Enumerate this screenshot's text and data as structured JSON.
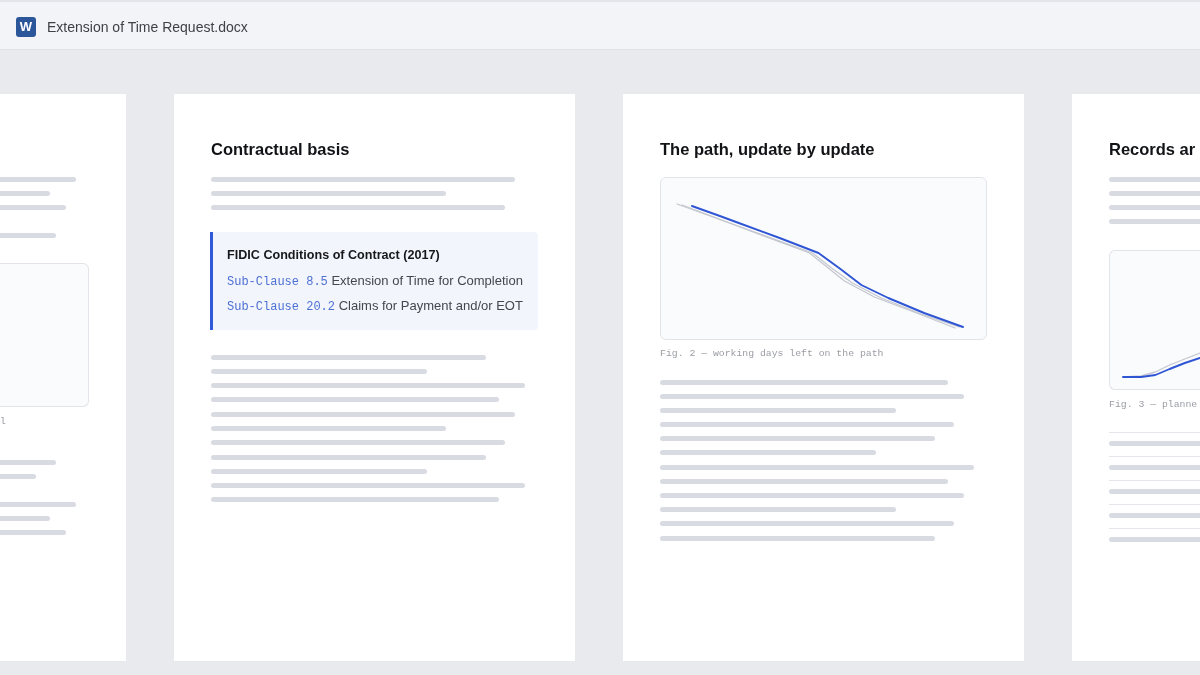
{
  "title_bar": {
    "app_icon_letter": "W",
    "document_name": "Extension of Time Request.docx"
  },
  "pages": [
    {
      "figure": {
        "caption": "l"
      }
    },
    {
      "heading": "Contractual basis",
      "callout": {
        "title": "FIDIC Conditions of Contract (2017)",
        "clauses": [
          {
            "reference": "Sub-Clause 8.5",
            "text": "Extension of Time for Completion"
          },
          {
            "reference": "Sub-Clause 20.2",
            "text": "Claims for Payment and/or EOT"
          }
        ]
      }
    },
    {
      "heading": "The path, update by update",
      "figure": {
        "kind": "burndown",
        "caption": "Fig. 2 — working days left on the path"
      }
    },
    {
      "heading": "Records ar",
      "figure": {
        "kind": "s_curve",
        "caption": "Fig. 3 — planne"
      }
    }
  ]
}
